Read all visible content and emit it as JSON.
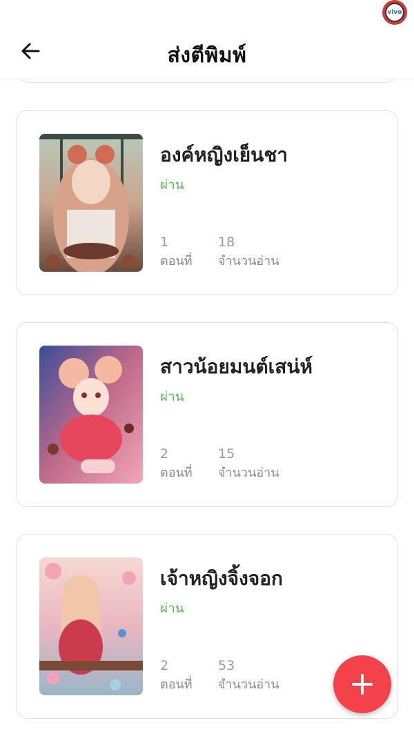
{
  "header": {
    "title": "ส่งตีพิมพ์",
    "back_icon": "arrow-left-icon",
    "badge_text": "vivo"
  },
  "stories": [
    {
      "title": "องค์หญิงเย็นชา",
      "status": "ผ่าน",
      "episodes": "1",
      "episodes_label": "ตอนที่",
      "reads": "18",
      "reads_label": "จำนวนอ่าน"
    },
    {
      "title": "สาวน้อยมนต์เสน่ห์",
      "status": "ผ่าน",
      "episodes": "2",
      "episodes_label": "ตอนที่",
      "reads": "15",
      "reads_label": "จำนวนอ่าน"
    },
    {
      "title": "เจ้าหญิงจิ้งจอก",
      "status": "ผ่าน",
      "episodes": "2",
      "episodes_label": "ตอนที่",
      "reads": "53",
      "reads_label": "จำนวนอ่าน"
    }
  ],
  "fab": {
    "icon": "plus-icon"
  },
  "colors": {
    "status": "#5cb85c",
    "fab": "#f3424a",
    "muted": "#999999"
  }
}
